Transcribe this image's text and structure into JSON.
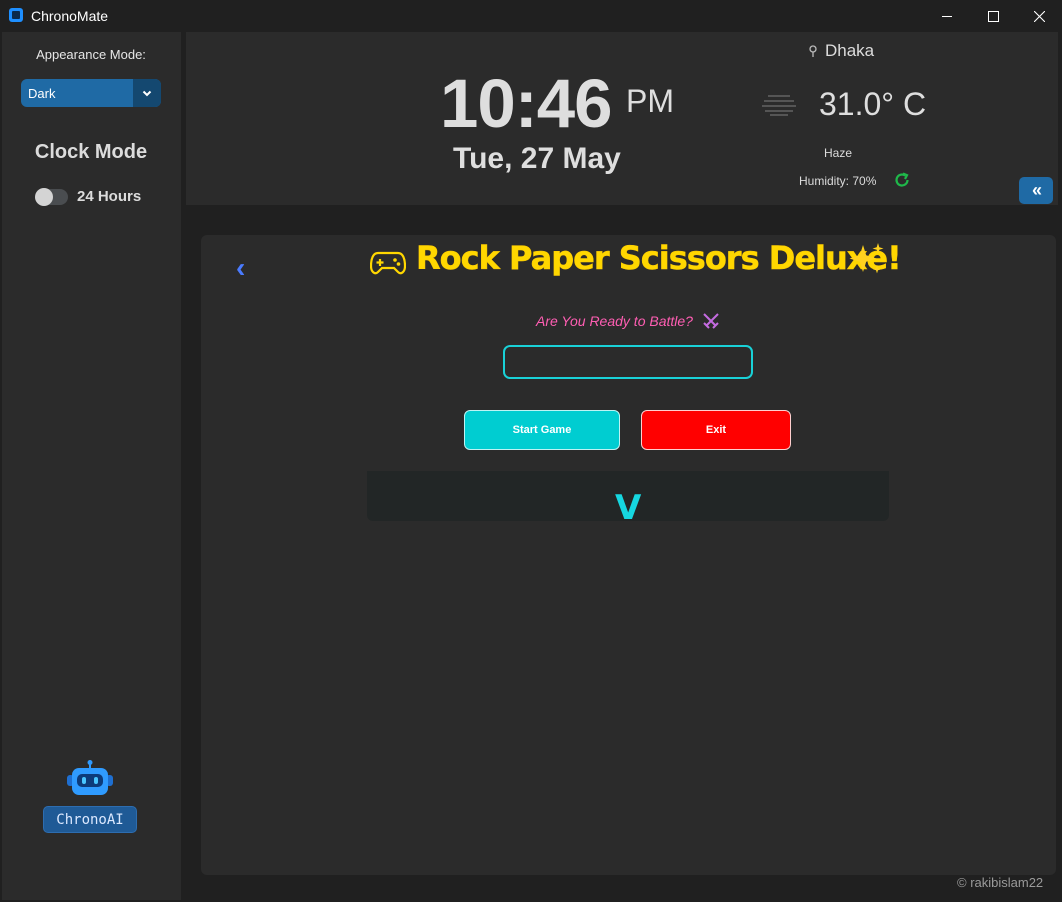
{
  "window": {
    "title": "ChronoMate"
  },
  "sidebar": {
    "appearance_label": "Appearance Mode:",
    "appearance_value": "Dark",
    "clock_mode_title": "Clock Mode",
    "toggle_label": "24 Hours",
    "toggle_on": false,
    "ai_button_label": "ChronoAI"
  },
  "clock": {
    "time": "10:46",
    "ampm": "PM",
    "date": "Tue, 27 May"
  },
  "weather": {
    "city": "Dhaka",
    "temperature": "31.0° C",
    "condition": "Haze",
    "humidity": "Humidity: 70%"
  },
  "game": {
    "back_label": "‹",
    "title": "Rock Paper Scissors Deluxe!",
    "prompt": "Are You Ready to Battle?",
    "name_input_value": "",
    "start_label": "Start Game",
    "exit_label": "Exit",
    "expand_label": "V"
  },
  "footer": {
    "copyright": "© rakibislam22"
  },
  "colors": {
    "accent": "#1f6aa5",
    "title_yellow": "#ffd700",
    "prompt_pink": "#ff5eb3",
    "cyan": "#00cdd1",
    "exit_red": "#ff0000"
  },
  "icons": [
    "app-icon",
    "chevron-down-icon",
    "pin-icon",
    "haze-icon",
    "refresh-icon",
    "collapse-icon",
    "back-icon",
    "gamepad-icon",
    "sparkles-icon",
    "swords-icon",
    "robot-icon"
  ]
}
